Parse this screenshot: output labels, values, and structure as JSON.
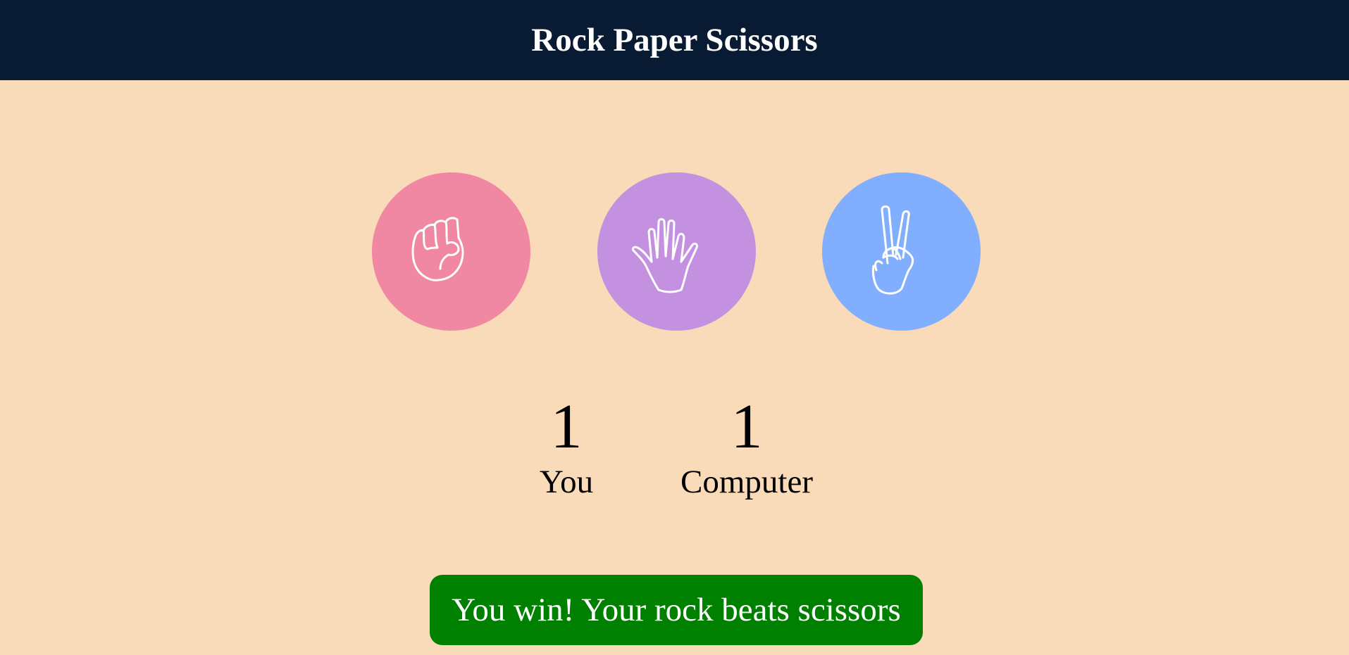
{
  "header": {
    "title": "Rock Paper Scissors"
  },
  "choices": [
    {
      "id": "rock",
      "icon": "rock-fist-icon",
      "color": "#f088a3"
    },
    {
      "id": "paper",
      "icon": "paper-hand-icon",
      "color": "#c391e0"
    },
    {
      "id": "scissors",
      "icon": "scissors-peace-icon",
      "color": "#82aeff"
    }
  ],
  "scoreboard": {
    "user": {
      "score": "1",
      "label": "You"
    },
    "computer": {
      "score": "1",
      "label": "Computer"
    }
  },
  "result": {
    "message": "You win! Your rock beats scissors",
    "color": "#008000"
  },
  "colors": {
    "background": "#f9dab9",
    "header": "#081b33",
    "header_text": "#ffffff",
    "result_text": "#ffffff"
  }
}
